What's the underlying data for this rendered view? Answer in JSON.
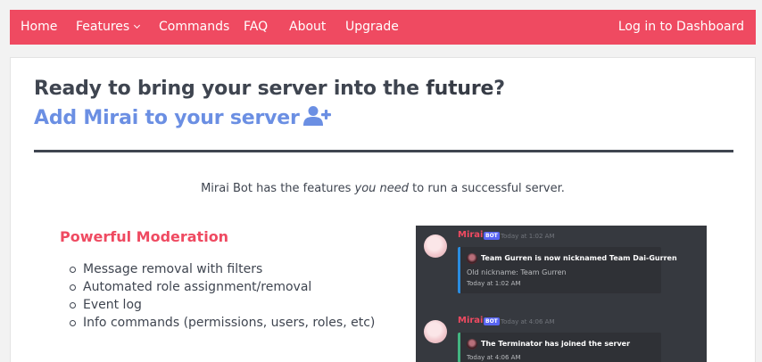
{
  "nav": {
    "home": "Home",
    "features": "Features",
    "commands": "Commands",
    "faq": "FAQ",
    "about": "About",
    "upgrade": "Upgrade",
    "login": "Log in to Dashboard"
  },
  "hero": {
    "title_prefix": "Ready to bring your server into the ",
    "title_strong": "future",
    "title_suffix": "?",
    "cta": "Add Mirai to your server",
    "cta_icon": "user-plus-icon"
  },
  "tagline": {
    "prefix": "Mirai Bot has the features ",
    "emphasis": "you need",
    "suffix": " to run a successful server."
  },
  "section": {
    "title": "Powerful Moderation",
    "features": [
      "Message removal with filters",
      "Automated role assignment/removal",
      "Event log",
      "Info commands (permissions, users, roles, etc)"
    ]
  },
  "preview": {
    "messages": [
      {
        "author": "Mirai",
        "tag": "BOT",
        "timestamp": "Today at 1:02 AM",
        "embed_title": "Team Gurren is now nicknamed Team Dai-Gurren",
        "embed_line": "Old nickname: Team Gurren",
        "embed_time": "Today at 1:02 AM",
        "accent": "#2a8ce0"
      },
      {
        "author": "Mirai",
        "tag": "BOT",
        "timestamp": "Today at 4:06 AM",
        "embed_title": "The Terminator has joined the server",
        "embed_time": "Today at 4:06 AM",
        "accent": "#43b581"
      }
    ]
  },
  "colors": {
    "brand": "#ef4a61",
    "cta": "#6b8fe3",
    "text": "#3f4550",
    "discord_bg": "#36393f"
  }
}
